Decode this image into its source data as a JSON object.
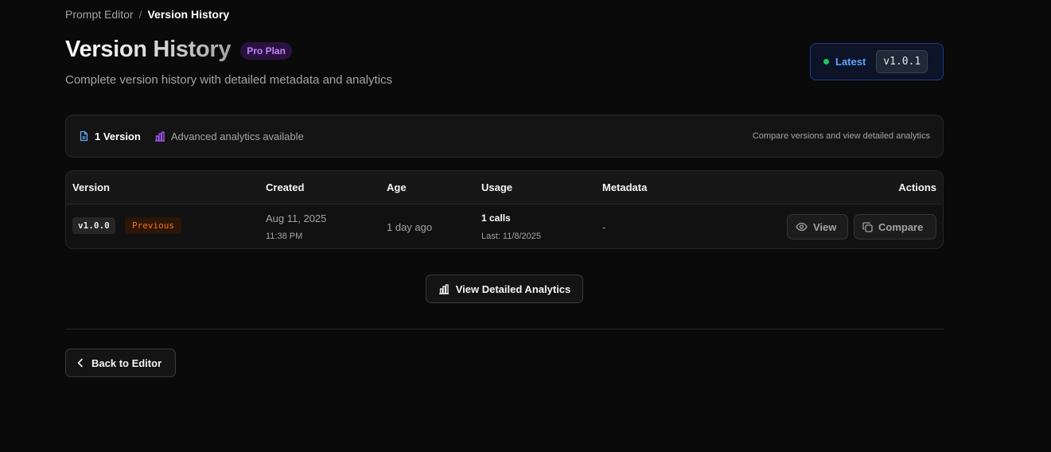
{
  "breadcrumb": {
    "parent": "Prompt Editor",
    "separator": "/",
    "current": "Version History"
  },
  "header": {
    "title": "Version History",
    "plan_badge": "Pro Plan",
    "subtitle": "Complete version history with detailed metadata and analytics",
    "latest_label": "Latest",
    "latest_version": "v1.0.1"
  },
  "info_bar": {
    "version_count": "1 Version",
    "analytics_text": "Advanced analytics available",
    "hint": "Compare versions and view detailed analytics"
  },
  "table": {
    "headers": {
      "version": "Version",
      "created": "Created",
      "age": "Age",
      "usage": "Usage",
      "metadata": "Metadata",
      "actions": "Actions"
    },
    "rows": [
      {
        "version": "v1.0.0",
        "status": "Previous",
        "created_date": "Aug 11, 2025",
        "created_time": "11:38 PM",
        "age": "1 day ago",
        "usage_calls": "1 calls",
        "usage_last": "Last: 11/8/2025",
        "metadata": "-",
        "view_label": "View",
        "compare_label": "Compare"
      }
    ]
  },
  "actions": {
    "analytics_label": "View Detailed Analytics",
    "back_label": "Back to Editor"
  },
  "colors": {
    "background": "#0a0a0a",
    "accent_blue": "#60a5fa",
    "accent_purple": "#c084fc",
    "status_green": "#22c55e",
    "previous_orange": "#f97316"
  },
  "icons": {
    "doc": "document-icon",
    "analytics": "bar-chart-icon",
    "view": "eye-icon",
    "compare": "copy-icon",
    "back": "chevron-left-icon"
  }
}
